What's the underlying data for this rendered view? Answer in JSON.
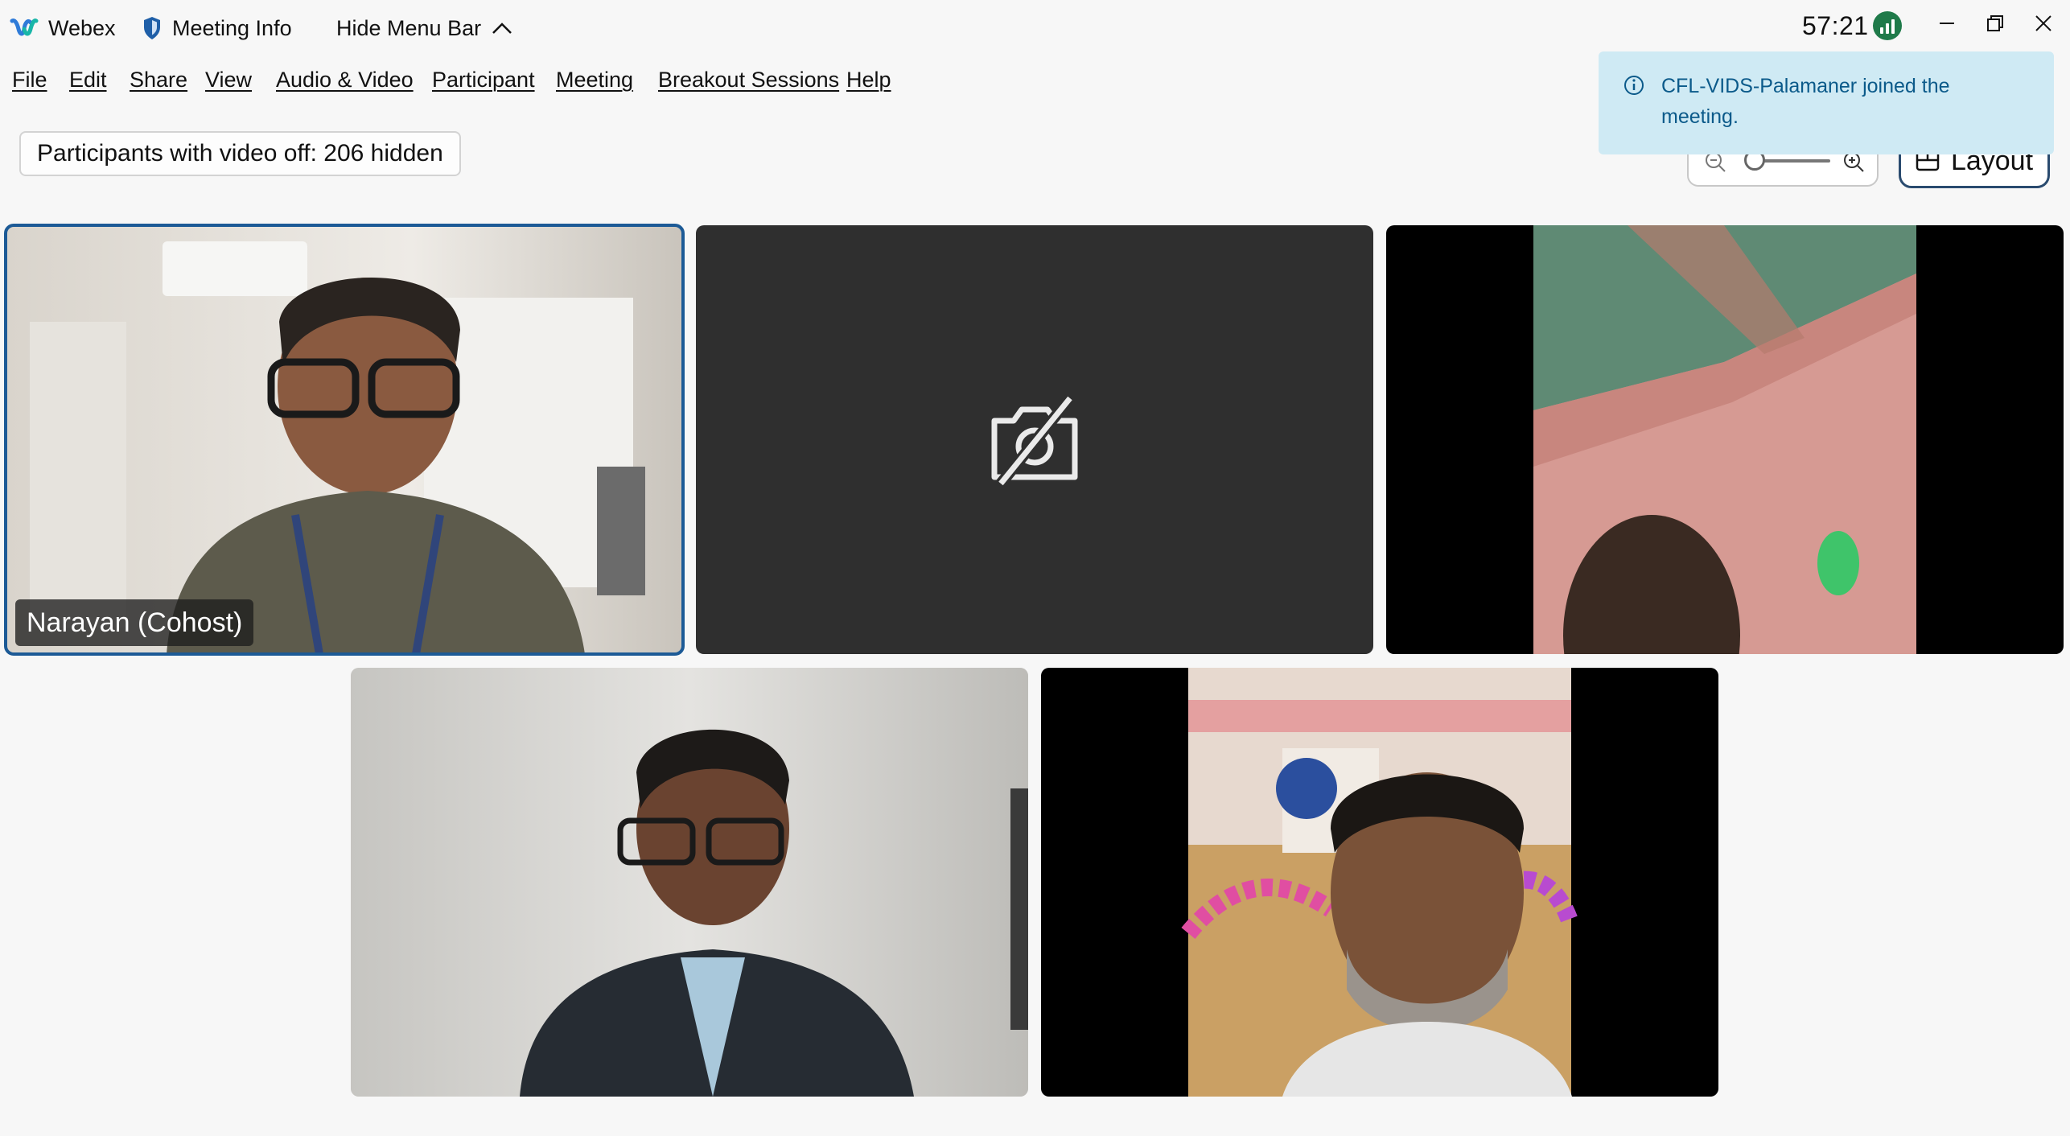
{
  "titlebar": {
    "app_name": "Webex",
    "meeting_info": "Meeting Info",
    "hide_menu_bar": "Hide Menu Bar",
    "timer": "57:21"
  },
  "menu": {
    "items": [
      "File",
      "Edit",
      "Share",
      "View",
      "Audio & Video",
      "Participant",
      "Meeting",
      "Breakout Sessions",
      "Help"
    ]
  },
  "hidden_participants": "Participants with video off: 206 hidden",
  "controls": {
    "layout_label": "Layout",
    "zoom_level": 0.05
  },
  "notification": {
    "text": "CFL-VIDS-Palamaner joined the meeting."
  },
  "tiles": [
    {
      "name": "Narayan (Cohost)",
      "active_speaker": true
    },
    {
      "name": "",
      "video_off": true
    },
    {
      "name": ""
    },
    {
      "name": ""
    },
    {
      "name": ""
    }
  ],
  "colors": {
    "accent": "#1c5a96",
    "toast_bg": "#cfeaf4",
    "toast_text": "#0b5a8a",
    "network_ok": "#1f7a4a"
  }
}
